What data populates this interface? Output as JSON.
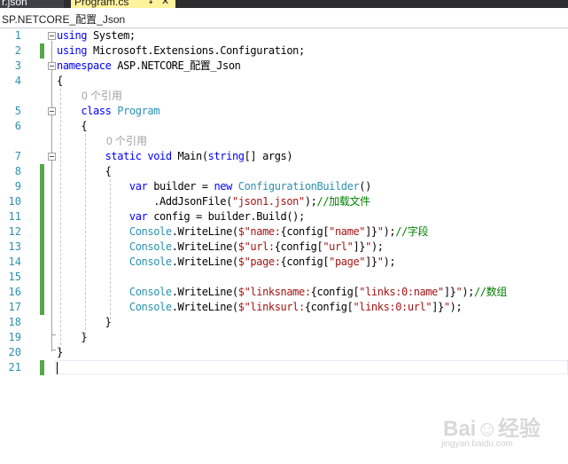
{
  "tabs": {
    "json_tab_label": "r.json",
    "program_tab_label": "Program.cs",
    "pin_glyph": "↧",
    "close_glyph": "✕"
  },
  "navbar": {
    "project": "SP.NETCORE_配置_Json"
  },
  "code_lens": [
    "0 个引用",
    "0 个引用"
  ],
  "line_numbers": [
    "1",
    "2",
    "3",
    "4",
    "5",
    "6",
    "7",
    "8",
    "9",
    "10",
    "11",
    "12",
    "13",
    "14",
    "15",
    "16",
    "17",
    "18",
    "19",
    "20",
    "21"
  ],
  "code": {
    "l1": [
      "using",
      " System;"
    ],
    "l2": [
      "using",
      " Microsoft.Extensions.Configuration;"
    ],
    "l3": [
      "namespace",
      " ASP.NETCORE_配置_Json"
    ],
    "l4": "{",
    "l5": [
      "class",
      "Program"
    ],
    "l6": "{",
    "l7": [
      "static",
      "void",
      " Main(",
      "string",
      "[] args)"
    ],
    "l8": "{",
    "l9": [
      "var",
      " builder = ",
      "new",
      "ConfigurationBuilder",
      "()"
    ],
    "l10": [
      ".AddJsonFile(",
      "\"json1.json\"",
      ");",
      "//加载文件"
    ],
    "l11": [
      "var",
      " config = builder.Build();"
    ],
    "l12": [
      "Console",
      ".WriteLine(",
      "$\"name:",
      "{config[",
      "\"name\"",
      "]}",
      "\"",
      ");",
      "//字段"
    ],
    "l13": [
      "Console",
      ".WriteLine(",
      "$\"url:",
      "{config[",
      "\"url\"",
      "]}",
      "\"",
      ");"
    ],
    "l14": [
      "Console",
      ".WriteLine(",
      "$\"page:",
      "{config[",
      "\"page\"",
      "]}",
      "\"",
      ");"
    ],
    "l16": [
      "Console",
      ".WriteLine(",
      "$\"linksname:",
      "{config[",
      "\"links:0:name\"",
      "]}",
      "\"",
      ");",
      "//数组"
    ],
    "l17": [
      "Console",
      ".WriteLine(",
      "$\"linksurl:",
      "{config[",
      "\"links:0:url\"",
      "]}",
      "\"",
      ");"
    ],
    "l18": "}",
    "l19": "}",
    "l20": "}"
  },
  "watermark": {
    "text": "Bai☺经验",
    "sub": "jingyan.baidu.com"
  },
  "colors": {
    "keyword": "#0000ff",
    "type": "#2b91af",
    "string": "#a31515",
    "comment": "#008000",
    "change_bar": "#57a64a",
    "line_number": "#2b91af"
  }
}
